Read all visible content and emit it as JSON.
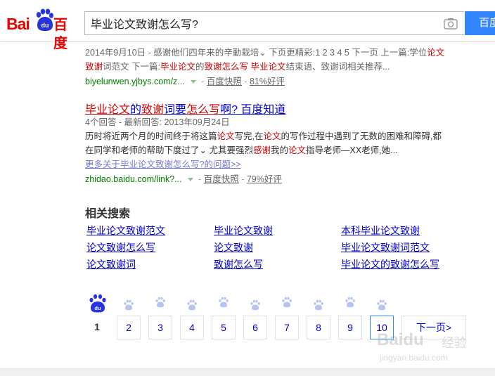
{
  "brand": {
    "logo_latin_1": "Bai",
    "logo_paw_text": "du",
    "logo_cn": "百度"
  },
  "search": {
    "query": "毕业论文致谢怎么写?",
    "button_label": "百度"
  },
  "result1": {
    "date": "2014年9月10日",
    "snippet_a": " - 感谢他们四年来的辛勤栽培⌄ 下页更精彩:1 2 3 4 5 下一页 上一篇:学位",
    "snippet_a_em": "论文",
    "snippet_b_em1": "致谢",
    "snippet_b_1": "词范文 下一篇:",
    "snippet_b_em2": "毕业论文",
    "snippet_b_2": "的",
    "snippet_b_em3": "致谢怎么写",
    "snippet_b_3": " ",
    "snippet_b_em4": "毕业论文",
    "snippet_b_4": "结束语、致谢词相关推荐...",
    "url": "biyelunwen.yjbys.com/z...",
    "snapshot": "百度快照",
    "rating": "81%好评"
  },
  "result2": {
    "title_em1": "毕业论文",
    "title_1": "的",
    "title_em2": "致谢",
    "title_2": "词要",
    "title_em3": "怎么写",
    "title_3": "啊? 百度知道",
    "meta": "4个回答 - 最新回答: 2013年09月24日",
    "line1_a": "历时将近两个月的时间终于将这篇",
    "line1_em1": "论文",
    "line1_b": "写完,在",
    "line1_em2": "论文",
    "line1_c": "的写作过程中遇到了无数的困难和障碍,都",
    "line2_a": "在同学和老师的帮助下度过了⌄ 尤其要强烈",
    "line2_em1": "感谢",
    "line2_b": "我的",
    "line2_em2": "论文",
    "line2_c": "指导老师—XX老师,她...",
    "more_link": "更多关于毕业论文致谢怎么写?的问题>>",
    "url": "zhidao.baidu.com/link?...",
    "snapshot": "百度快照",
    "rating": "79%好评"
  },
  "related": {
    "title": "相关搜索",
    "items": [
      "毕业论文致谢范文",
      "毕业论文致谢",
      "本科毕业论文致谢",
      "论文致谢怎么写",
      "论文致谢",
      "毕业论文致谢词范文",
      "论文致谢词",
      "致谢怎么写",
      "毕业论文的致谢怎么写"
    ]
  },
  "pager": {
    "current": "1",
    "pages": [
      "2",
      "3",
      "4",
      "5",
      "6",
      "7",
      "8",
      "9",
      "10"
    ],
    "next_label": "下一页>",
    "hovered_page": "10"
  },
  "watermark": {
    "brand": "Baidu",
    "cn": "经验",
    "url": "jingyan.baidu.com"
  },
  "colors": {
    "link": "#0000cc",
    "highlight": "#cc0000",
    "url": "#008000",
    "brand_red": "#e10602",
    "button": "#3385ff"
  },
  "icons": [
    "baidu-paw-logo-icon",
    "camera-icon",
    "paw-page-icon",
    "caret-down-icon"
  ]
}
